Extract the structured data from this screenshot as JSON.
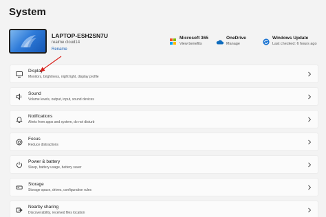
{
  "page": {
    "title": "System"
  },
  "device": {
    "name": "LAPTOP-ESH2SN7U",
    "model": "realme cloud14",
    "rename_label": "Rename"
  },
  "quick_links": [
    {
      "title": "Microsoft 365",
      "subtitle": "View benefits",
      "icon": "microsoft-365-icon"
    },
    {
      "title": "OneDrive",
      "subtitle": "Manage",
      "icon": "onedrive-icon"
    },
    {
      "title": "Windows Update",
      "subtitle": "Last checked: 6 hours ago",
      "icon": "windows-update-icon"
    }
  ],
  "settings": [
    {
      "title": "Display",
      "subtitle": "Monitors, brightness, night light, display profile",
      "icon": "display-icon"
    },
    {
      "title": "Sound",
      "subtitle": "Volume levels, output, input, sound devices",
      "icon": "sound-icon"
    },
    {
      "title": "Notifications",
      "subtitle": "Alerts from apps and system, do not disturb",
      "icon": "bell-icon"
    },
    {
      "title": "Focus",
      "subtitle": "Reduce distractions",
      "icon": "focus-icon"
    },
    {
      "title": "Power & battery",
      "subtitle": "Sleep, battery usage, battery saver",
      "icon": "power-icon"
    },
    {
      "title": "Storage",
      "subtitle": "Storage space, drives, configuration rules",
      "icon": "storage-icon"
    },
    {
      "title": "Nearby sharing",
      "subtitle": "Discoverability, received files location",
      "icon": "nearby-sharing-icon"
    }
  ],
  "colors": {
    "accent": "#1a62b8",
    "annotation_arrow": "#d9211c",
    "background": "#f3f3f3",
    "card": "#fbfbfb"
  }
}
